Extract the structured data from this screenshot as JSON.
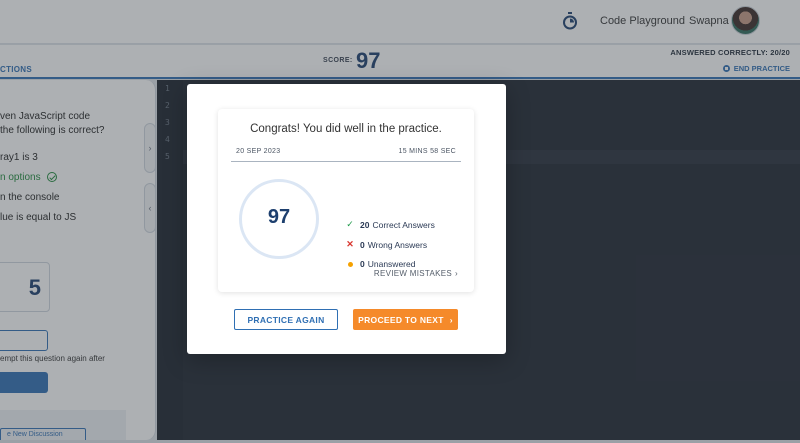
{
  "header": {
    "nav_link": "Code Playground",
    "user_name": "Swapna"
  },
  "scorebar": {
    "questions_tab": "CTIONS",
    "score_label": "SCORE:",
    "score_value": "97",
    "answered_correctly": "ANSWERED CORRECTLY: 20/20",
    "end_practice": "END PRACTICE"
  },
  "question": {
    "line1": "ven JavaScript code",
    "line2": "the following is correct?",
    "options": [
      "ray1 is 3",
      "n options",
      "n the console",
      "lue is equal to JS"
    ],
    "answer_box": "5",
    "attempt_text": "empt this question again after",
    "discussion_button": "e New Discussion"
  },
  "editor": {
    "line_numbers": [
      "1",
      "2",
      "3",
      "4",
      "5"
    ],
    "active_marker": "f"
  },
  "modal": {
    "congrats": "Congrats! You did well in the practice.",
    "date": "20 SEP 2023",
    "duration": "15 MINS 58 SEC",
    "score": "97",
    "stats": [
      {
        "count": "20",
        "label": "Correct Answers",
        "icon": "check-icon"
      },
      {
        "count": "0",
        "label": "Wrong Answers",
        "icon": "cross-icon"
      },
      {
        "count": "0",
        "label": "Unanswered",
        "icon": "dot-icon"
      }
    ],
    "review_mistakes": "REVIEW MISTAKES",
    "practice_again": "PRACTICE AGAIN",
    "proceed_to_next": "PROCEED TO NEXT"
  },
  "colors": {
    "primary": "#2f6fb3",
    "accent_orange": "#f58a2a",
    "correct_green": "#1f9a4a",
    "wrong_red": "#d8362e",
    "unanswered_yellow": "#f5a100",
    "score_navy": "#1d3f6e"
  }
}
